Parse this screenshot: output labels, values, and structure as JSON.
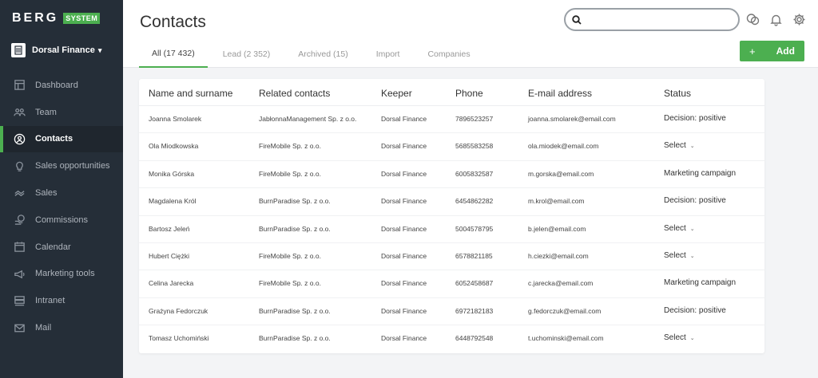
{
  "brand": {
    "name": "BERG",
    "badge": "SYSTEM"
  },
  "org": {
    "name": "Dorsal Finance"
  },
  "nav": [
    {
      "label": "Dashboard",
      "icon": "dashboard-icon"
    },
    {
      "label": "Team",
      "icon": "team-icon"
    },
    {
      "label": "Contacts",
      "icon": "contacts-icon",
      "active": true
    },
    {
      "label": "Sales opportunities",
      "icon": "lightbulb-icon"
    },
    {
      "label": "Sales",
      "icon": "sales-icon"
    },
    {
      "label": "Commissions",
      "icon": "commissions-icon"
    },
    {
      "label": "Calendar",
      "icon": "calendar-icon"
    },
    {
      "label": "Marketing tools",
      "icon": "megaphone-icon"
    },
    {
      "label": "Intranet",
      "icon": "intranet-icon"
    },
    {
      "label": "Mail",
      "icon": "mail-icon"
    }
  ],
  "header": {
    "title": "Contacts",
    "search_placeholder": "",
    "add_label": "Add",
    "add_plus": "+"
  },
  "tabs": [
    {
      "label": "All (17 432)",
      "active": true
    },
    {
      "label": "Lead (2 352)"
    },
    {
      "label": "Archived (15)"
    },
    {
      "label": "Import"
    },
    {
      "label": "Companies"
    }
  ],
  "table": {
    "columns": [
      "Name and surname",
      "Related contacts",
      "Keeper",
      "Phone",
      "E-mail address",
      "Status"
    ],
    "rows": [
      {
        "name": "Joanna Smolarek",
        "related": "JabłonnaManagement Sp. z o.o.",
        "keeper": "Dorsal Finance",
        "phone": "7896523257",
        "email": "joanna.smolarek@email.com",
        "status": "Decision: positive",
        "select": false
      },
      {
        "name": "Ola Miodkowska",
        "related": "FireMobile Sp. z o.o.",
        "keeper": "Dorsal Finance",
        "phone": "5685583258",
        "email": "ola.miodek@email.com",
        "status": "Select",
        "select": true
      },
      {
        "name": "Monika Górska",
        "related": "FireMobile Sp. z o.o.",
        "keeper": "Dorsal Finance",
        "phone": "6005832587",
        "email": "m.gorska@email.com",
        "status": "Marketing campaign",
        "select": false
      },
      {
        "name": "Magdalena Król",
        "related": "BurnParadise Sp. z o.o.",
        "keeper": "Dorsal Finance",
        "phone": "6454862282",
        "email": "m.krol@email.com",
        "status": "Decision: positive",
        "select": false
      },
      {
        "name": "Bartosz Jeleń",
        "related": "BurnParadise Sp. z o.o.",
        "keeper": "Dorsal Finance",
        "phone": "5004578795",
        "email": "b.jelen@email.com",
        "status": "Select",
        "select": true
      },
      {
        "name": "Hubert Ciężki",
        "related": "FireMobile Sp. z o.o.",
        "keeper": "Dorsal Finance",
        "phone": "6578821185",
        "email": "h.ciezki@email.com",
        "status": "Select",
        "select": true
      },
      {
        "name": "Celina Jarecka",
        "related": "FireMobile Sp. z o.o.",
        "keeper": "Dorsal Finance",
        "phone": "6052458687",
        "email": "c.jarecka@email.com",
        "status": "Marketing campaign",
        "select": false
      },
      {
        "name": "Grażyna Fedorczuk",
        "related": "BurnParadise Sp. z o.o.",
        "keeper": "Dorsal Finance",
        "phone": "6972182183",
        "email": "g.fedorczuk@email.com",
        "status": "Decision: positive",
        "select": false
      },
      {
        "name": "Tomasz Uchomiński",
        "related": "BurnParadise Sp. z o.o.",
        "keeper": "Dorsal Finance",
        "phone": "6448792548",
        "email": "t.uchominski@email.com",
        "status": "Select",
        "select": true
      }
    ]
  },
  "colors": {
    "accent": "#4caf50",
    "sidebar": "#252e38"
  }
}
